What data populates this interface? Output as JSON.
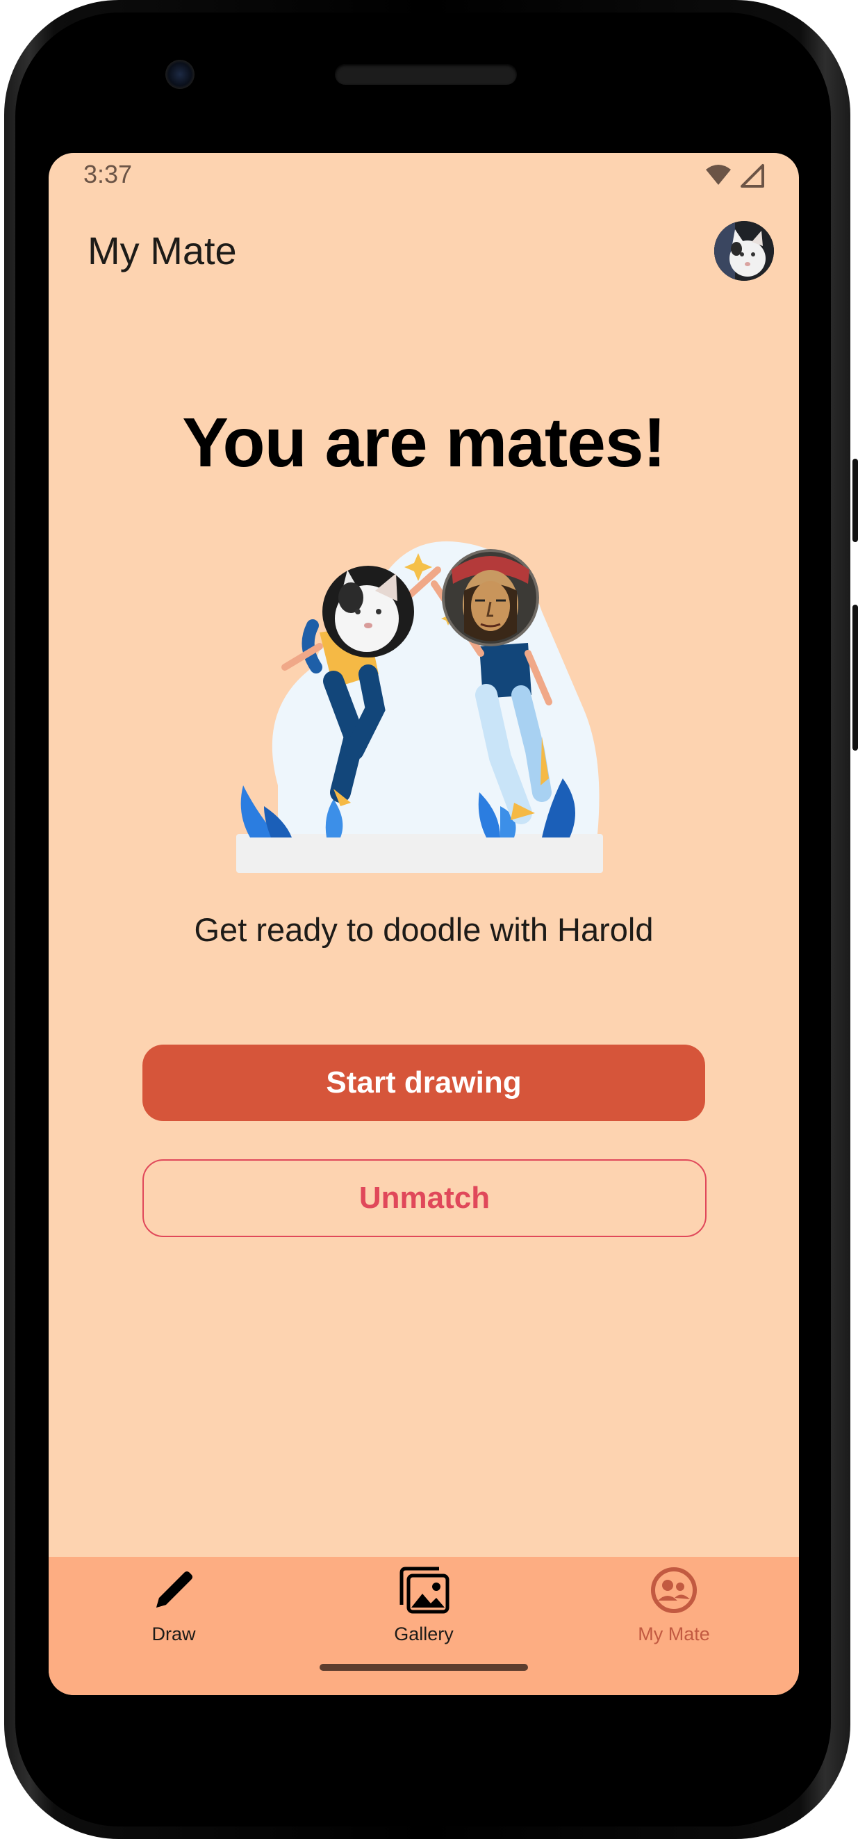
{
  "status_bar": {
    "time": "3:37",
    "wifi_icon": "wifi-icon",
    "signal_icon": "cell-signal-icon"
  },
  "app_bar": {
    "title": "My Mate",
    "avatar_icon": "profile-avatar"
  },
  "main": {
    "headline": "You are mates!",
    "subtitle": "Get ready to doodle with Harold",
    "primary_button": "Start drawing",
    "secondary_button": "Unmatch"
  },
  "bottom_nav": {
    "items": [
      {
        "label": "Draw",
        "icon": "pencil-icon",
        "active": false
      },
      {
        "label": "Gallery",
        "icon": "gallery-icon",
        "active": false
      },
      {
        "label": "My Mate",
        "icon": "people-icon",
        "active": true
      }
    ]
  },
  "colors": {
    "background": "#fdd3b0",
    "nav_background": "#fdad82",
    "primary": "#d6553a",
    "danger": "#e0485a",
    "active_nav": "#c25a41"
  }
}
